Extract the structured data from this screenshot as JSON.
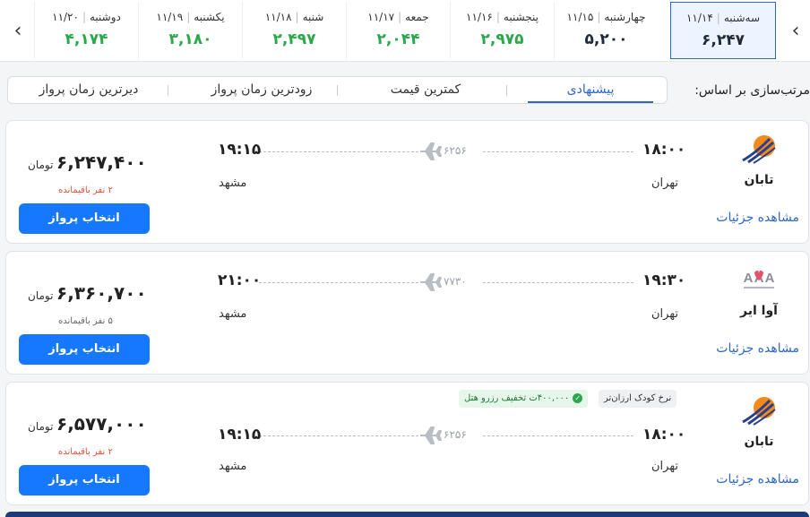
{
  "dates": [
    {
      "day": "سه‌شنبه",
      "date": "۱۱/۱۴",
      "price": "۶,۲۴۷",
      "selected": true,
      "price_color": "dark"
    },
    {
      "day": "چهارشنبه",
      "date": "۱۱/۱۵",
      "price": "۵,۲۰۰",
      "selected": false,
      "price_color": "dark"
    },
    {
      "day": "پنجشنبه",
      "date": "۱۱/۱۶",
      "price": "۲,۹۷۵",
      "selected": false,
      "price_color": "green"
    },
    {
      "day": "جمعه",
      "date": "۱۱/۱۷",
      "price": "۲,۰۴۴",
      "selected": false,
      "price_color": "green"
    },
    {
      "day": "شنبه",
      "date": "۱۱/۱۸",
      "price": "۲,۴۹۷",
      "selected": false,
      "price_color": "green"
    },
    {
      "day": "یکشنبه",
      "date": "۱۱/۱۹",
      "price": "۳,۱۸۰",
      "selected": false,
      "price_color": "green"
    },
    {
      "day": "دوشنبه",
      "date": "۱۱/۲۰",
      "price": "۴,۱۷۴",
      "selected": false,
      "price_color": "green"
    }
  ],
  "sort": {
    "label": "مرتب‌سازی بر اساس:",
    "options": [
      "پیشنهادی",
      "کمترین قیمت",
      "زودترین زمان پرواز",
      "دیرترین زمان پرواز"
    ],
    "active": "پیشنهادی"
  },
  "flights": [
    {
      "airline": "تابان",
      "logo_icon": "taban-logo-icon",
      "dep_time": "۱۸:۰۰",
      "dep_city": "تهران",
      "arr_time": "۱۹:۱۵",
      "arr_city": "مشهد",
      "flight_no": "۶۲۵۶",
      "price": "۶,۲۴۷,۴۰۰",
      "unit": "تومان",
      "seats": "۲ نفر باقیمانده",
      "seats_color": "red",
      "select_label": "انتخاب پرواز",
      "details_label": "مشاهده جزئیات",
      "badges": []
    },
    {
      "airline": "آوا ایر",
      "logo_icon": "ava-air-logo-icon",
      "dep_time": "۱۹:۳۰",
      "dep_city": "تهران",
      "arr_time": "۲۱:۰۰",
      "arr_city": "مشهد",
      "flight_no": "۷۷۳۰",
      "price": "۶,۳۶۰,۷۰۰",
      "unit": "تومان",
      "seats": "۵ نفر باقیمانده",
      "seats_color": "gray",
      "select_label": "انتخاب پرواز",
      "details_label": "مشاهده جزئیات",
      "badges": []
    },
    {
      "airline": "تابان",
      "logo_icon": "taban-logo-icon",
      "dep_time": "۱۸:۰۰",
      "dep_city": "تهران",
      "arr_time": "۱۹:۱۵",
      "arr_city": "مشهد",
      "flight_no": "۶۲۵۶",
      "price": "۶,۵۷۷,۰۰۰",
      "unit": "تومان",
      "seats": "۲ نفر باقیمانده",
      "seats_color": "red",
      "select_label": "انتخاب پرواز",
      "details_label": "مشاهده جزئیات",
      "badges": [
        "نرخ کودک ارزان‌تر",
        "۴۰۰,۰۰۰ت تخفیف رزرو هتل"
      ]
    }
  ],
  "colors": {
    "accent": "#1677ff",
    "green": "#2aa84a",
    "link": "#2c68c8",
    "warning": "#e0533c"
  }
}
